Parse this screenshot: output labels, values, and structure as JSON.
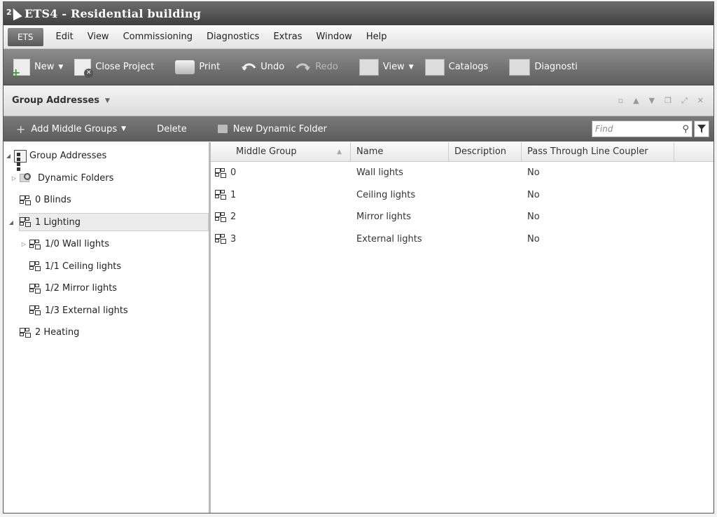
{
  "window": {
    "title": "ETS4 - Residential building",
    "logo_text": "2"
  },
  "menu": {
    "app_button": "ETS",
    "items": [
      "Edit",
      "View",
      "Commissioning",
      "Diagnostics",
      "Extras",
      "Window",
      "Help"
    ]
  },
  "toolbar": {
    "new": "New",
    "close_project": "Close Project",
    "print": "Print",
    "undo": "Undo",
    "redo": "Redo",
    "view": "View",
    "catalogs": "Catalogs",
    "diagnostics": "Diagnosti"
  },
  "panel": {
    "title": "Group Addresses",
    "add_middle_groups": "Add Middle Groups",
    "delete": "Delete",
    "new_dynamic_folder": "New Dynamic Folder",
    "find_placeholder": "Find"
  },
  "tree": {
    "root": "Group Addresses",
    "dynamic_folders": "Dynamic Folders",
    "blinds": "0 Blinds",
    "lighting": "1 Lighting",
    "wall": "1/0 Wall lights",
    "ceiling": "1/1 Ceiling lights",
    "mirror": "1/2 Mirror lights",
    "external": "1/3 External lights",
    "heating": "2 Heating"
  },
  "grid": {
    "columns": {
      "middle_group": "Middle Group",
      "name": "Name",
      "description": "Description",
      "pass_through": "Pass Through Line Coupler"
    },
    "rows": [
      {
        "middle_group": "0",
        "name": "Wall lights",
        "description": "",
        "pass_through": "No"
      },
      {
        "middle_group": "1",
        "name": "Ceiling lights",
        "description": "",
        "pass_through": "No"
      },
      {
        "middle_group": "2",
        "name": "Mirror lights",
        "description": "",
        "pass_through": "No"
      },
      {
        "middle_group": "3",
        "name": "External lights",
        "description": "",
        "pass_through": "No"
      }
    ]
  }
}
